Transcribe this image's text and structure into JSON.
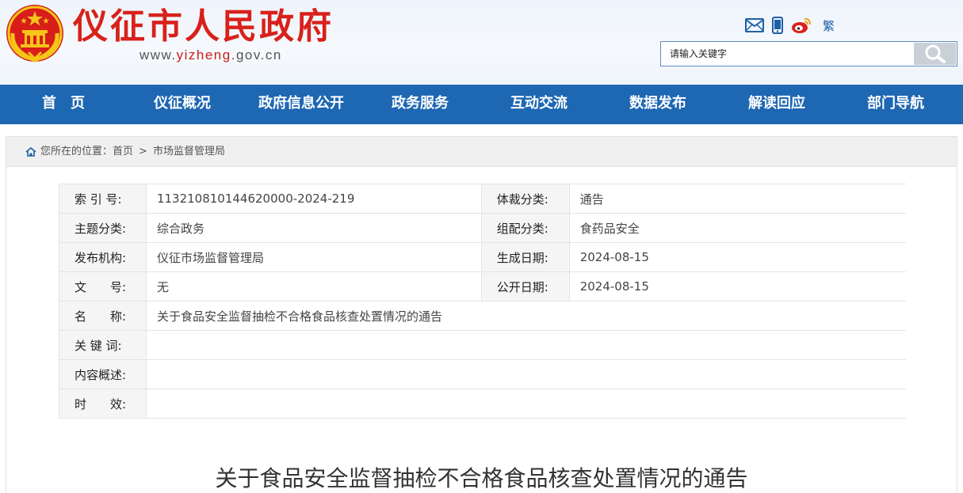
{
  "header": {
    "site_title": "仪征市人民政府",
    "domain_prefix": "www.",
    "domain_highlight": "yizheng",
    "domain_suffix": ".gov.cn",
    "traditional_label": "繁",
    "icons": [
      "mail-icon",
      "mobile-icon",
      "weibo-icon"
    ],
    "brand_red": "#d8211b"
  },
  "search": {
    "placeholder": "请输入关键字",
    "button_icon": "search-icon"
  },
  "nav": {
    "bg_color": "#1e67b3",
    "items": [
      "首　页",
      "仪征概况",
      "政府信息公开",
      "政务服务",
      "互动交流",
      "数据发布",
      "解读回应",
      "部门导航"
    ]
  },
  "breadcrumb": {
    "prefix": "您所在的位置：",
    "home": "首页",
    "separator": ">",
    "current": "市场监督管理局"
  },
  "meta": {
    "rows": [
      {
        "k1": "索 引 号:",
        "v1": "113210810144620000-2024-219",
        "k2": "体裁分类:",
        "v2": "通告"
      },
      {
        "k1": "主题分类:",
        "v1": "综合政务",
        "k2": "组配分类:",
        "v2": "食药品安全"
      },
      {
        "k1": "发布机构:",
        "v1": "仪征市场监督管理局",
        "k2": "生成日期:",
        "v2": "2024-08-15"
      },
      {
        "k1": "文　　号:",
        "v1": "无",
        "k2": "公开日期:",
        "v2": "2024-08-15"
      }
    ],
    "full_rows": [
      {
        "k": "名　　称:",
        "v": "关于食品安全监督抽检不合格食品核查处置情况的通告"
      },
      {
        "k": "关 键 词:",
        "v": ""
      },
      {
        "k": "内容概述:",
        "v": ""
      },
      {
        "k": "时　　效:",
        "v": ""
      }
    ]
  },
  "document": {
    "title": "关于食品安全监督抽检不合格食品核查处置情况的通告"
  }
}
